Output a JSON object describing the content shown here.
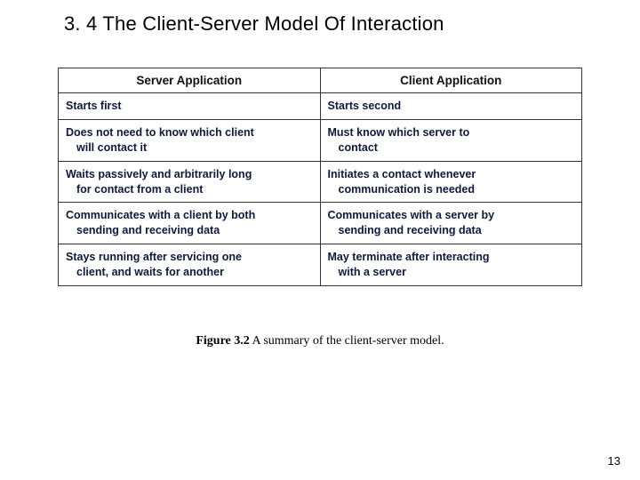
{
  "heading": "3. 4  The Client-Server Model Of Interaction",
  "table": {
    "headers": {
      "left": "Server Application",
      "right": "Client Application"
    },
    "rows": [
      {
        "left": {
          "line1": "Starts first",
          "line2": ""
        },
        "right": {
          "line1": "Starts second",
          "line2": ""
        }
      },
      {
        "left": {
          "line1": "Does not need to know which client",
          "line2": "will contact it"
        },
        "right": {
          "line1": "Must know which server to",
          "line2": "contact"
        }
      },
      {
        "left": {
          "line1": "Waits passively and arbitrarily long",
          "line2": "for contact from a client"
        },
        "right": {
          "line1": "Initiates a contact whenever",
          "line2": "communication is needed"
        }
      },
      {
        "left": {
          "line1": "Communicates with a client by both",
          "line2": "sending and receiving data"
        },
        "right": {
          "line1": "Communicates with a server by",
          "line2": "sending and receiving data"
        }
      },
      {
        "left": {
          "line1": "Stays running after servicing one",
          "line2": "client, and waits for another"
        },
        "right": {
          "line1": "May terminate after interacting",
          "line2": "with a server"
        }
      }
    ]
  },
  "caption": {
    "label": "Figure 3.2",
    "text": " A summary of the client-server model."
  },
  "page_number": "13"
}
